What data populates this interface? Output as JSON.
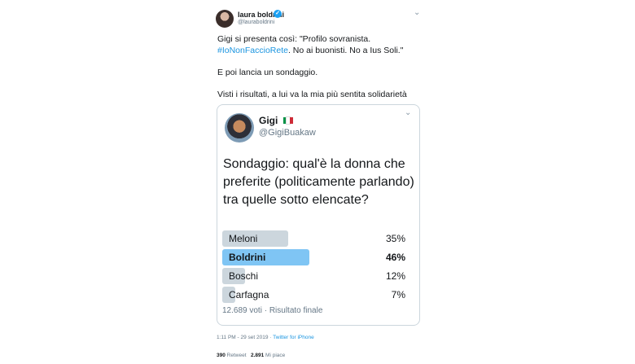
{
  "author": {
    "name": "laura boldrini",
    "handle": "@lauraboldrini",
    "verified_glyph": "✓",
    "caret": "⌄",
    "avatar_icon": "avatar-photo"
  },
  "tweet": {
    "lines": [
      {
        "text": "Gigi si presenta così: \"Profilo sovranista."
      },
      {
        "hashtag": "#IoNonFaccioRete",
        "rest": ". No ai buonisti. No a Ius Soli.\""
      },
      {
        "text": "E poi lancia un sondaggio."
      },
      {
        "text": "Visti i risultati, a lui va la mia più sentita solidarietà"
      }
    ]
  },
  "quoted": {
    "name": "Gigi",
    "handle": "@GigiBuakaw",
    "caret": "⌄",
    "flag_colors": [
      "#009246",
      "#ffffff",
      "#ce2b37"
    ],
    "text_lines": [
      "Sondaggio: qual'è la donna che",
      "preferite (politicamente parlando)",
      "tra quelle sotto elencate?"
    ],
    "poll": {
      "options": [
        {
          "label": "Meloni",
          "percent": 35,
          "percent_label": "35%",
          "winner": false
        },
        {
          "label": "Boldrini",
          "percent": 46,
          "percent_label": "46%",
          "winner": true
        },
        {
          "label": "Boschi",
          "percent": 12,
          "percent_label": "12%",
          "winner": false
        },
        {
          "label": "Carfagna",
          "percent": 7,
          "percent_label": "7%",
          "winner": false
        }
      ],
      "footer": "12.689 voti · Risultato finale"
    }
  },
  "meta": {
    "time": "1:11 PM - 29 set 2019 · ",
    "via": "Twitter for iPhone",
    "retweets": "390",
    "retweets_label": "Retweet",
    "likes": "2.891",
    "likes_label": "Mi piace"
  },
  "colors": {
    "bar": "#ccd6dd",
    "bar_winner": "#7fc5f4",
    "link": "#1b95e0",
    "verified": "#1da1f2"
  }
}
